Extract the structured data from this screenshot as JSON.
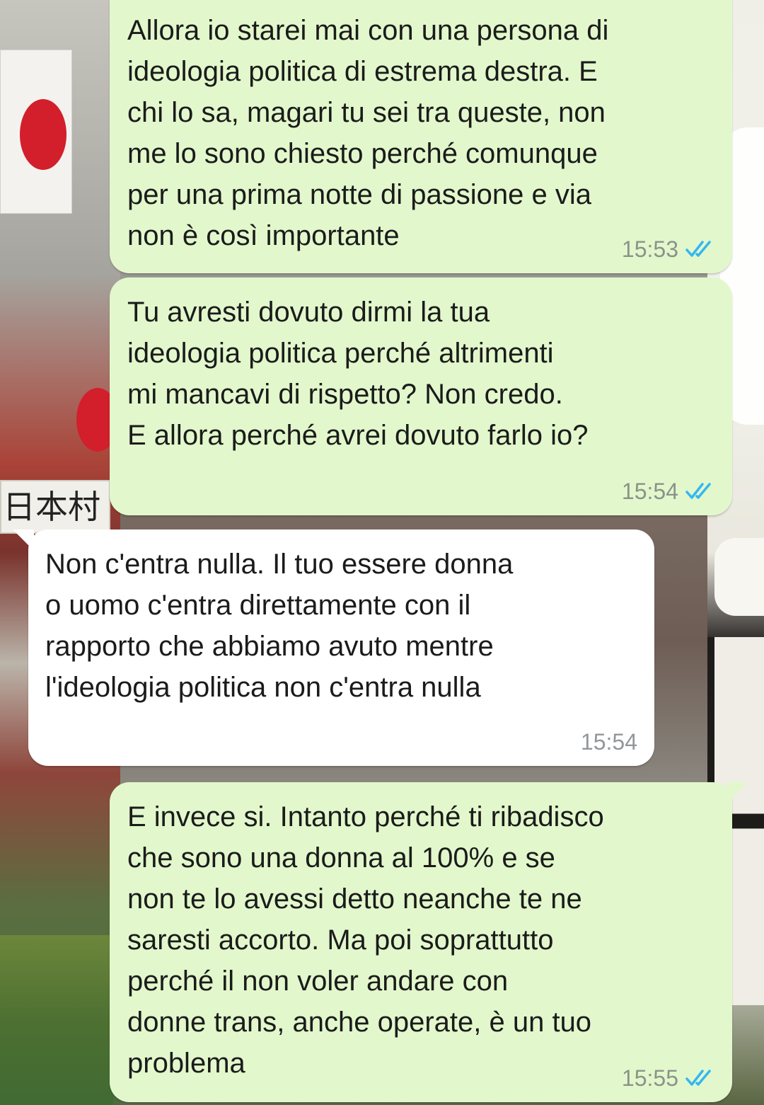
{
  "wallpaper": {
    "sign_text": "日本村"
  },
  "colors": {
    "outgoing_bubble": "#e2f8cc",
    "incoming_bubble": "#ffffff",
    "read_ticks": "#34b7f1",
    "timestamp": "#8a9389"
  },
  "messages": [
    {
      "direction": "outgoing",
      "text": "Allora io starei mai con una persona di\nideologia politica di estrema destra. E\nchi lo sa, magari tu sei tra queste, non\nme lo sono chiesto perché comunque\nper una prima notte di passione e via\nnon è così importante",
      "time": "15:53",
      "status_icon": "double-check-read-icon"
    },
    {
      "direction": "outgoing",
      "text": "Tu avresti dovuto dirmi la tua\nideologia politica perché altrimenti\nmi mancavi di rispetto? Non credo.\nE allora perché avrei dovuto farlo io?",
      "time": "15:54",
      "status_icon": "double-check-read-icon"
    },
    {
      "direction": "incoming",
      "text": "Non c'entra nulla. Il tuo essere donna\no uomo c'entra direttamente con il\nrapporto che abbiamo avuto mentre\nl'ideologia politica non c'entra nulla",
      "time": "15:54"
    },
    {
      "direction": "outgoing",
      "text": "E invece si. Intanto perché ti ribadisco\nche sono una donna al 100% e se\nnon te lo avessi detto neanche te ne\nsaresti accorto. Ma poi soprattutto\nperché il non voler andare con\ndonne trans, anche operate, è un tuo\nproblema",
      "time": "15:55",
      "status_icon": "double-check-read-icon"
    }
  ]
}
